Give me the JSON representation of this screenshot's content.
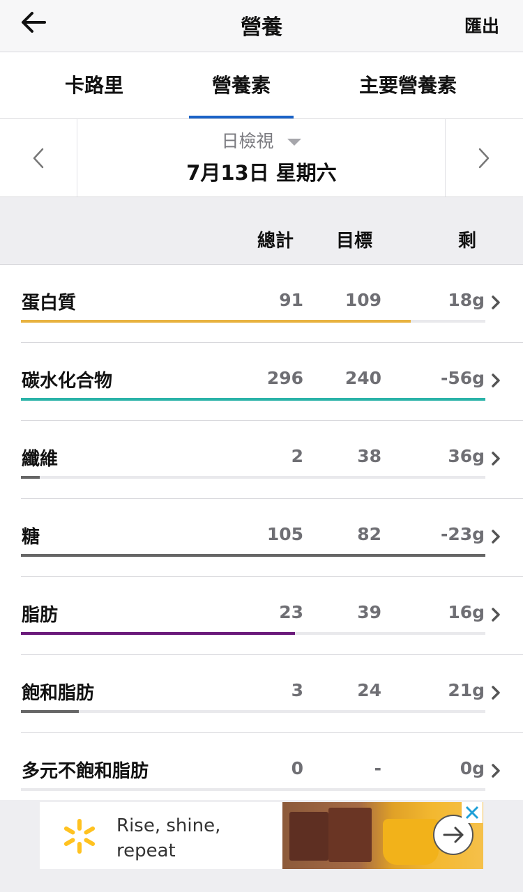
{
  "header": {
    "title": "營養",
    "export_label": "匯出"
  },
  "tabs": [
    {
      "label": "卡路里"
    },
    {
      "label": "營養素"
    },
    {
      "label": "主要營養素"
    }
  ],
  "date_nav": {
    "view_label": "日檢視",
    "date": "7月13日 星期六"
  },
  "columns": {
    "total": "總計",
    "goal": "目標",
    "left": "剩"
  },
  "nutrients": [
    {
      "name": "蛋白質",
      "total": "91",
      "goal": "109",
      "left": "18g",
      "progress": 0.84,
      "color": "#e8b240"
    },
    {
      "name": "碳水化合物",
      "total": "296",
      "goal": "240",
      "left": "-56g",
      "progress": 1.0,
      "color": "#2bb3a8"
    },
    {
      "name": "纖維",
      "total": "2",
      "goal": "38",
      "left": "36g",
      "progress": 0.04,
      "color": "#666666"
    },
    {
      "name": "糖",
      "total": "105",
      "goal": "82",
      "left": "-23g",
      "progress": 1.0,
      "color": "#666666"
    },
    {
      "name": "脂肪",
      "total": "23",
      "goal": "39",
      "left": "16g",
      "progress": 0.59,
      "color": "#6a1a7a"
    },
    {
      "name": "飽和脂肪",
      "total": "3",
      "goal": "24",
      "left": "21g",
      "progress": 0.125,
      "color": "#666666"
    },
    {
      "name": "多元不飽和脂肪",
      "total": "0",
      "goal": "-",
      "left": "0g",
      "progress": 0,
      "color": "#666666"
    }
  ],
  "ad": {
    "line1": "Rise, shine,",
    "line2": "repeat",
    "brand_color": "#ffc220"
  }
}
